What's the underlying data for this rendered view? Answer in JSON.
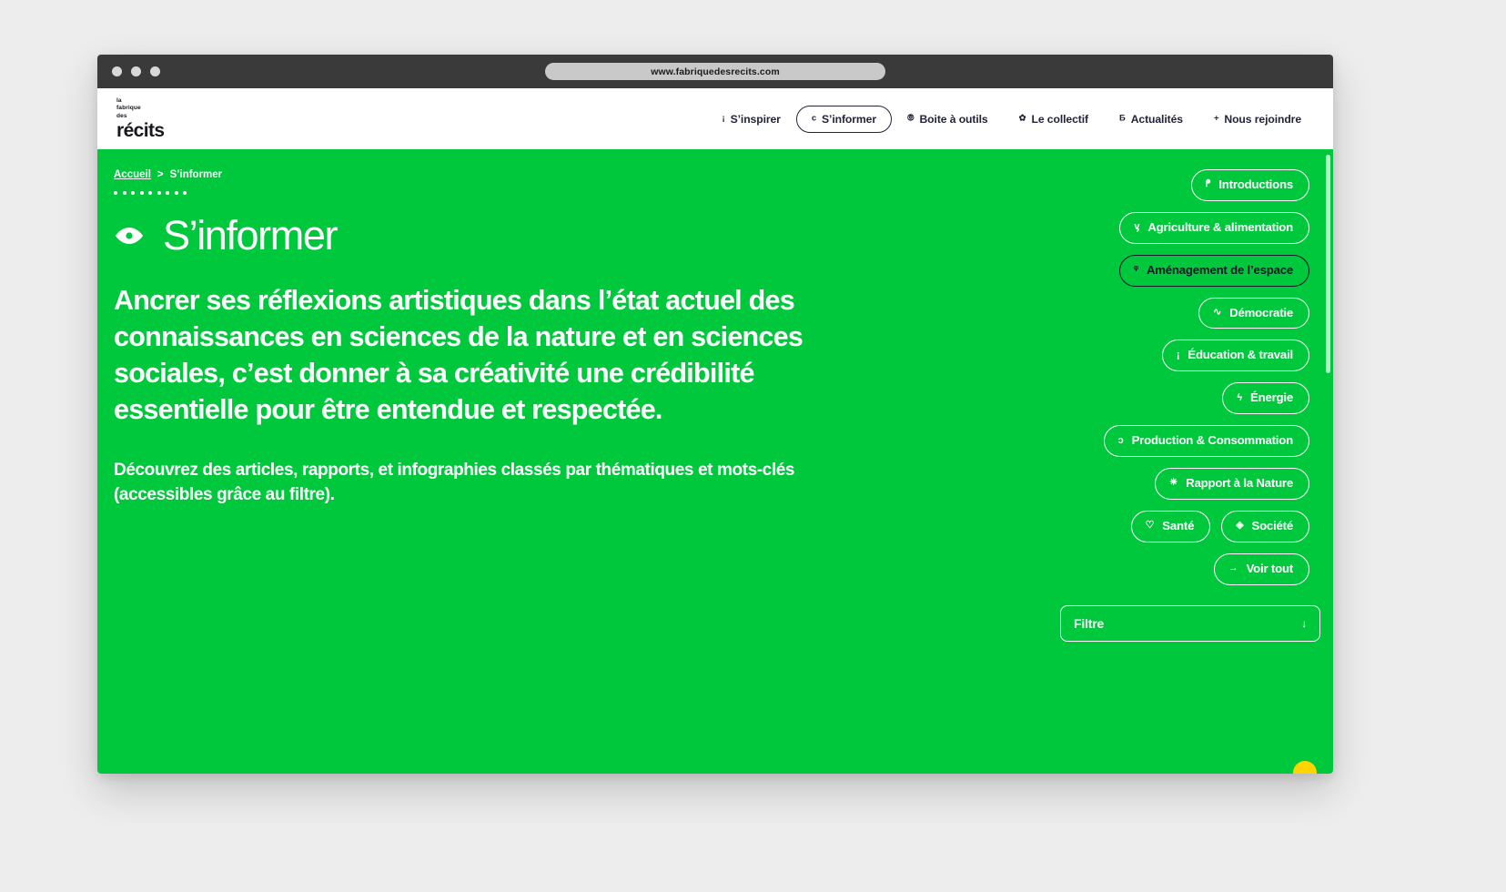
{
  "browser": {
    "url": "www.fabriquedesrecits.com",
    "traffic_lights": [
      "close",
      "minimize",
      "maximize"
    ]
  },
  "site": {
    "logo": {
      "line1": "la",
      "line2": "fabrique",
      "line3": "des",
      "wordmark": "récits"
    },
    "nav": [
      {
        "icon": "info-icon",
        "glyph": "¡",
        "label": "S’inspirer",
        "active": false
      },
      {
        "icon": "eye-icon",
        "glyph": "c",
        "label": "S’informer",
        "active": true
      },
      {
        "icon": "tool-icon",
        "glyph": "⦾",
        "label": "Boite à outils",
        "active": false
      },
      {
        "icon": "star-icon",
        "glyph": "✿",
        "label": "Le collectif",
        "active": false
      },
      {
        "icon": "news-icon",
        "glyph": "Ƃ",
        "label": "Actualités",
        "active": false
      },
      {
        "icon": "plus-icon",
        "glyph": "+",
        "label": "Nous rejoindre",
        "active": false
      }
    ]
  },
  "breadcrumb": {
    "home": "Accueil",
    "separator": ">",
    "current": "S’informer",
    "dot_count": 9
  },
  "hero": {
    "icon": "eye-icon",
    "title": "S’informer",
    "lead": "Ancrer ses réflexions artistiques dans l’état actuel des connaissances en sciences de la nature et en sciences sociales, c’est donner à sa créativité une crédibilité essentielle pour être entendue et respectée.",
    "subtext": "Découvrez des articles, rapports, et infographies classés par thématiques et mots-clés (accessibles grâce au filtre)."
  },
  "categories": [
    {
      "icon": "speech-bubble-icon",
      "glyph": "ᖰ",
      "label": "Introductions",
      "selected": false
    },
    {
      "icon": "leaf-icon",
      "glyph": "ᶌ",
      "label": "Agriculture & alimentation",
      "selected": false
    },
    {
      "icon": "pin-icon",
      "glyph": "ᵠ",
      "label": "Aménagement de l’espace",
      "selected": true
    },
    {
      "icon": "wave-icon",
      "glyph": "∿",
      "label": "Démocratie",
      "selected": false
    },
    {
      "icon": "info-icon",
      "glyph": "¡",
      "label": "Éducation & travail",
      "selected": false
    },
    {
      "icon": "lightning-icon",
      "glyph": "ϟ",
      "label": "Énergie",
      "selected": false
    },
    {
      "icon": "recycle-icon",
      "glyph": "ↄ",
      "label": "Production & Consommation",
      "selected": false
    },
    {
      "icon": "sun-icon",
      "glyph": "✷",
      "label": "Rapport à la Nature",
      "selected": false
    },
    {
      "icon": "heart-icon",
      "glyph": "♡",
      "label": "Santé",
      "selected": false
    },
    {
      "icon": "diamond-icon",
      "glyph": "◈",
      "label": "Société",
      "selected": false
    },
    {
      "icon": "arrow-right-icon",
      "glyph": "→",
      "label": "Voir tout",
      "selected": false
    }
  ],
  "filter": {
    "label": "Filtre",
    "caret": "↓"
  },
  "colors": {
    "brand_green": "#00c83c",
    "ink": "#16182b",
    "white": "#ffffff",
    "titlebar": "#3a3a3a",
    "accent_yellow": "#ffd400"
  }
}
